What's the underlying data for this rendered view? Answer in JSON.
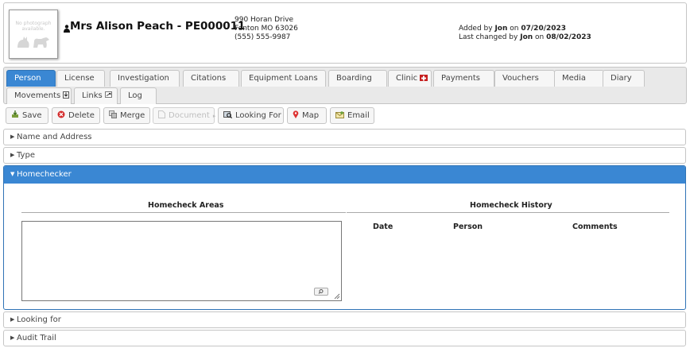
{
  "header": {
    "photo_placeholder": "No photograph available.",
    "title": "Mrs Alison Peach - PE000011",
    "address_line1": "990 Horan Drive",
    "address_line2": "Fenton MO 63026",
    "phone": "(555) 555-9987",
    "added_prefix": "Added by",
    "added_by": "Jon",
    "added_on_word": "on",
    "added_date": "07/20/2023",
    "changed_prefix": "Last changed by",
    "changed_by": "Jon",
    "changed_on_word": "on",
    "changed_date": "08/02/2023"
  },
  "tabs": [
    {
      "label": "Person"
    },
    {
      "label": "License"
    },
    {
      "label": "Investigation"
    },
    {
      "label": "Citations"
    },
    {
      "label": "Equipment Loans"
    },
    {
      "label": "Boarding"
    },
    {
      "label": "Clinic"
    },
    {
      "label": "Payments"
    },
    {
      "label": "Vouchers"
    },
    {
      "label": "Media"
    },
    {
      "label": "Diary"
    },
    {
      "label": "Movements"
    },
    {
      "label": "Links"
    },
    {
      "label": "Log"
    }
  ],
  "active_tab": "Person",
  "toolbar": {
    "save": "Save",
    "delete": "Delete",
    "merge": "Merge",
    "document": "Document",
    "looking_for": "Looking For",
    "map": "Map",
    "email": "Email"
  },
  "sections": {
    "name_address": "Name and Address",
    "type": "Type",
    "homechecker": "Homechecker",
    "looking_for": "Looking for",
    "audit_trail": "Audit Trail"
  },
  "homechecker": {
    "areas_title": "Homecheck Areas",
    "areas_value": "",
    "history_title": "Homecheck History",
    "history_columns": [
      "Date",
      "Person",
      "Comments"
    ]
  },
  "colors": {
    "accent": "#3a87d3",
    "border": "#c5c5c5",
    "tab_bg": "#f6f6f6"
  }
}
